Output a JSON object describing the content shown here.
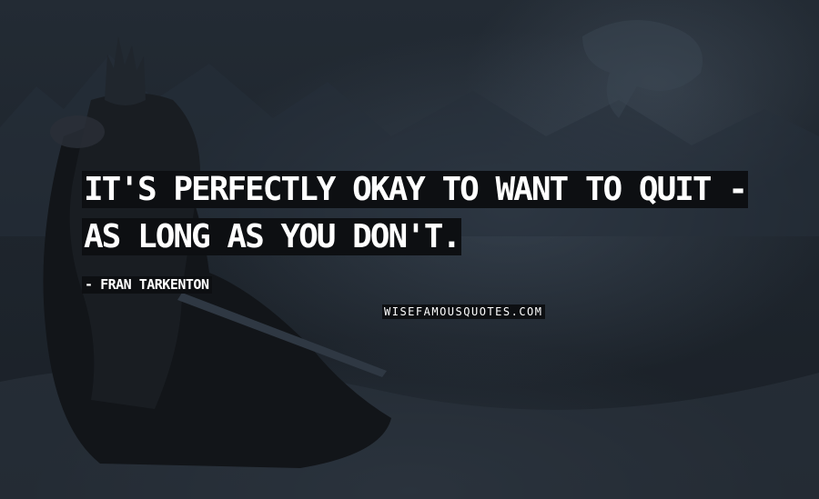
{
  "quote": {
    "text": "IT'S PERFECTLY OKAY TO WANT TO QUIT - AS LONG AS YOU DON'T."
  },
  "author": {
    "prefix": "-",
    "name": "FRAN TARKENTON"
  },
  "watermark": {
    "text": "WISEFAMOUSQUOTES.COM"
  },
  "colors": {
    "text": "#ffffff",
    "label_background": "#0d0f12",
    "scene_background": "#1c2229"
  }
}
